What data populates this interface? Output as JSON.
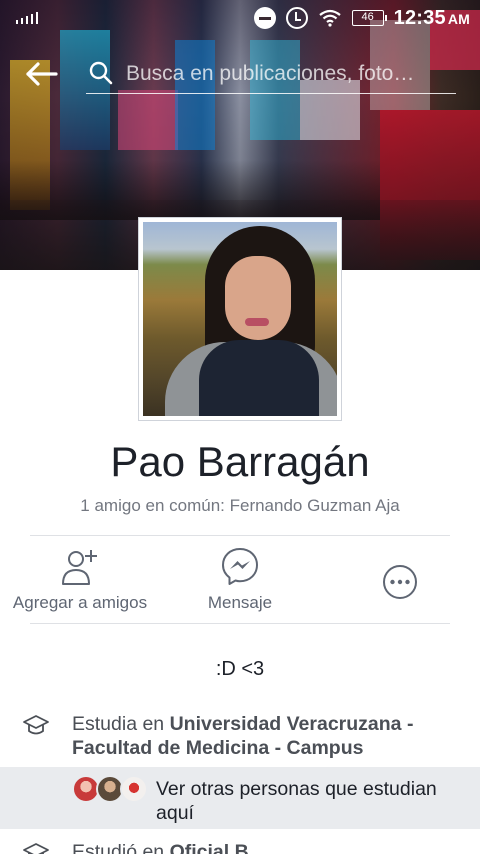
{
  "status_bar": {
    "battery": "46",
    "time": "12:35",
    "ampm": "AM"
  },
  "header": {
    "search_placeholder": "Busca en publicaciones, foto…"
  },
  "profile": {
    "name": "Pao Barragán",
    "mutual_friends": "1 amigo en común: Fernando Guzman Aja",
    "bio": ":D <3"
  },
  "actions": {
    "add_friend": "Agregar a amigos",
    "message": "Mensaje"
  },
  "education": {
    "current_prefix": "Estudia en ",
    "current_school_line1": "Universidad Veracruzana -",
    "current_school_line2": "Facultad de Medicina - Campus",
    "others_line1": "Ver otras personas que estudian",
    "others_line2": "aquí",
    "past_prefix": "Estudió en ",
    "past_school": "Oficial B"
  },
  "colors": {
    "text_primary": "#1d2129",
    "text_secondary": "#737780",
    "icon_gray": "#5f6673",
    "row_highlight": "#e9ebee"
  }
}
